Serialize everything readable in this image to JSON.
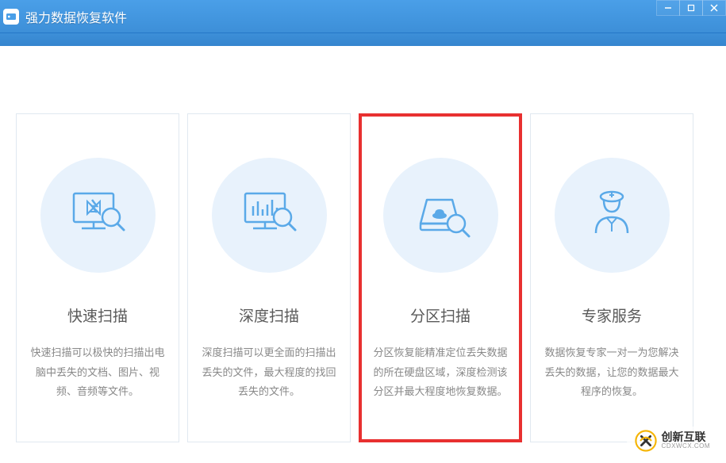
{
  "app": {
    "title": "强力数据恢复软件"
  },
  "cards": [
    {
      "title": "快速扫描",
      "desc": "快速扫描可以极快的扫描出电脑中丢失的文档、图片、视频、音频等文件。"
    },
    {
      "title": "深度扫描",
      "desc": "深度扫描可以更全面的扫描出丢失的文件，最大程度的找回丢失的文件。"
    },
    {
      "title": "分区扫描",
      "desc": "分区恢复能精准定位丢失数据的所在硬盘区域，深度检测该分区并最大程度地恢复数据。"
    },
    {
      "title": "专家服务",
      "desc": "数据恢复专家一对一为您解决丢失的数据，让您的数据最大程序的恢复。"
    }
  ],
  "watermark": {
    "cn": "创新互联",
    "en": "CDXWCX.COM"
  }
}
